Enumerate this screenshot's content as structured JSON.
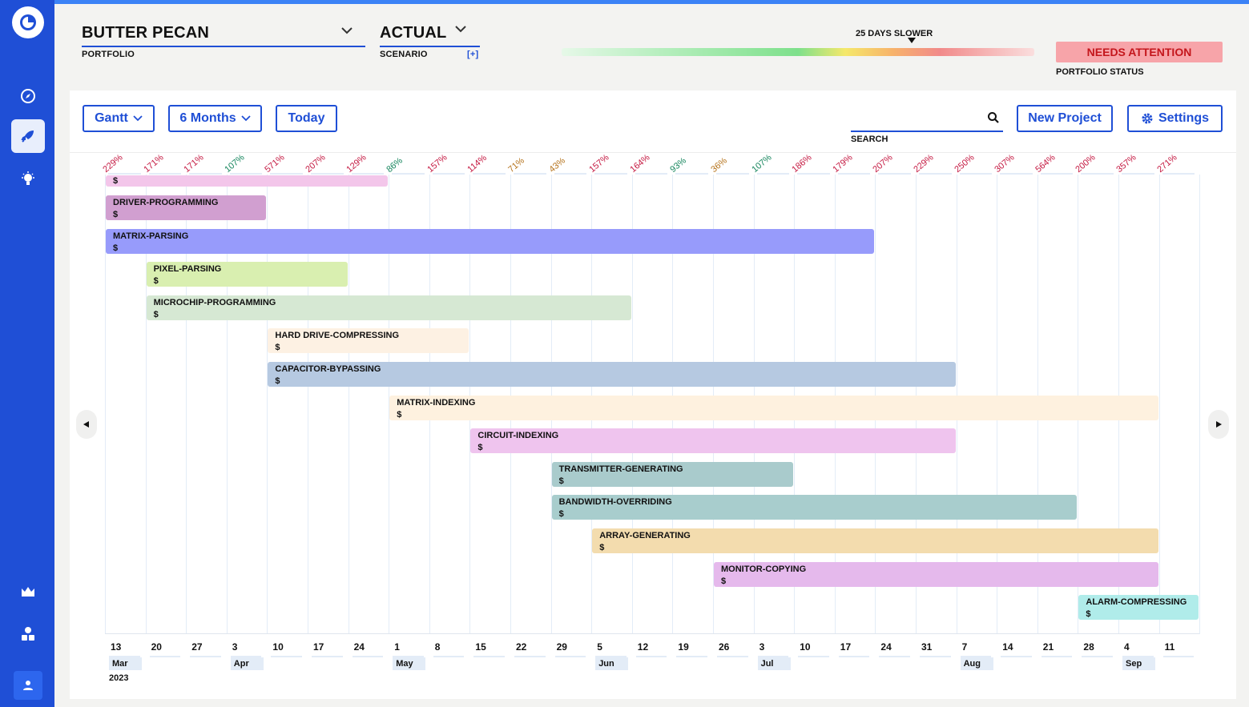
{
  "colors": {
    "accent": "#1f4fd6",
    "sidebar": "#1f4fd6",
    "status_bg": "#f7a4a9",
    "status_text": "#c4161c",
    "over": "#c4163f",
    "under": "#14855c",
    "warn": "#b5721a"
  },
  "header": {
    "portfolio": {
      "value": "BUTTER PECAN",
      "caption": "PORTFOLIO"
    },
    "scenario": {
      "value": "ACTUAL",
      "caption": "SCENARIO",
      "add": "[+]"
    },
    "schedule": "25 DAYS SLOWER",
    "status": {
      "value": "NEEDS ATTENTION",
      "caption": "PORTFOLIO STATUS"
    }
  },
  "toolbar": {
    "view": "Gantt",
    "range": "6 Months",
    "today": "Today",
    "search_caption": "SEARCH",
    "new_project": "New Project",
    "settings": "Settings"
  },
  "nav": [
    "dashboard-icon",
    "rocket-icon",
    "lightbulb-icon",
    "crown-icon",
    "team-icon",
    "user-icon"
  ],
  "utilization": [
    {
      "v": "229%",
      "c": "over"
    },
    {
      "v": "171%",
      "c": "over"
    },
    {
      "v": "171%",
      "c": "over"
    },
    {
      "v": "107%",
      "c": "under"
    },
    {
      "v": "571%",
      "c": "over"
    },
    {
      "v": "207%",
      "c": "over"
    },
    {
      "v": "129%",
      "c": "over"
    },
    {
      "v": "86%",
      "c": "under"
    },
    {
      "v": "157%",
      "c": "over"
    },
    {
      "v": "114%",
      "c": "over"
    },
    {
      "v": "71%",
      "c": "warn"
    },
    {
      "v": "43%",
      "c": "warn"
    },
    {
      "v": "157%",
      "c": "over"
    },
    {
      "v": "164%",
      "c": "over"
    },
    {
      "v": "93%",
      "c": "under"
    },
    {
      "v": "36%",
      "c": "warn"
    },
    {
      "v": "107%",
      "c": "under"
    },
    {
      "v": "186%",
      "c": "over"
    },
    {
      "v": "179%",
      "c": "over"
    },
    {
      "v": "207%",
      "c": "over"
    },
    {
      "v": "229%",
      "c": "over"
    },
    {
      "v": "250%",
      "c": "over"
    },
    {
      "v": "307%",
      "c": "over"
    },
    {
      "v": "564%",
      "c": "over"
    },
    {
      "v": "200%",
      "c": "over"
    },
    {
      "v": "357%",
      "c": "over"
    },
    {
      "v": "271%",
      "c": "over"
    }
  ],
  "weeks": [
    "13",
    "20",
    "27",
    "3",
    "10",
    "17",
    "24",
    "1",
    "8",
    "15",
    "22",
    "29",
    "5",
    "12",
    "19",
    "26",
    "3",
    "10",
    "17",
    "24",
    "31",
    "7",
    "14",
    "21",
    "28",
    "4",
    "11"
  ],
  "months": [
    {
      "label": "Mar",
      "week": 0
    },
    {
      "label": "Apr",
      "week": 3
    },
    {
      "label": "May",
      "week": 7
    },
    {
      "label": "Jun",
      "week": 12
    },
    {
      "label": "Jul",
      "week": 16
    },
    {
      "label": "Aug",
      "week": 21
    },
    {
      "label": "Sep",
      "week": 25
    }
  ],
  "year": "2023",
  "projects": [
    {
      "name": "",
      "cost": "$",
      "start": 0,
      "end": 7,
      "color": "#f3c6ea"
    },
    {
      "name": "DRIVER-PROGRAMMING",
      "cost": "$",
      "start": 0,
      "end": 4,
      "color": "#d19fd0"
    },
    {
      "name": "MATRIX-PARSING",
      "cost": "$",
      "start": 0,
      "end": 19,
      "color": "#979bfb"
    },
    {
      "name": "PIXEL-PARSING",
      "cost": "$",
      "start": 1,
      "end": 6,
      "color": "#d9efb0"
    },
    {
      "name": "MICROCHIP-PROGRAMMING",
      "cost": "$",
      "start": 1,
      "end": 13,
      "color": "#d6e8d3"
    },
    {
      "name": "HARD DRIVE-COMPRESSING",
      "cost": "$",
      "start": 4,
      "end": 9,
      "color": "#fdf1e3"
    },
    {
      "name": "CAPACITOR-BYPASSING",
      "cost": "$",
      "start": 4,
      "end": 21,
      "color": "#b6c9e1"
    },
    {
      "name": "MATRIX-INDEXING",
      "cost": "$",
      "start": 7,
      "end": 26,
      "color": "#fef1df"
    },
    {
      "name": "CIRCUIT-INDEXING",
      "cost": "$",
      "start": 9,
      "end": 21,
      "color": "#efc4ee"
    },
    {
      "name": "TRANSMITTER-GENERATING",
      "cost": "$",
      "start": 11,
      "end": 17,
      "color": "#a9cbcc"
    },
    {
      "name": "BANDWIDTH-OVERRIDING",
      "cost": "$",
      "start": 11,
      "end": 24,
      "color": "#a8cdcd"
    },
    {
      "name": "ARRAY-GENERATING",
      "cost": "$",
      "start": 12,
      "end": 26,
      "color": "#f3dcae"
    },
    {
      "name": "MONITOR-COPYING",
      "cost": "$",
      "start": 15,
      "end": 26,
      "color": "#e5b9ec"
    },
    {
      "name": "ALARM-COMPRESSING",
      "cost": "$",
      "start": 24,
      "end": 27,
      "color": "#b0ecea"
    }
  ]
}
